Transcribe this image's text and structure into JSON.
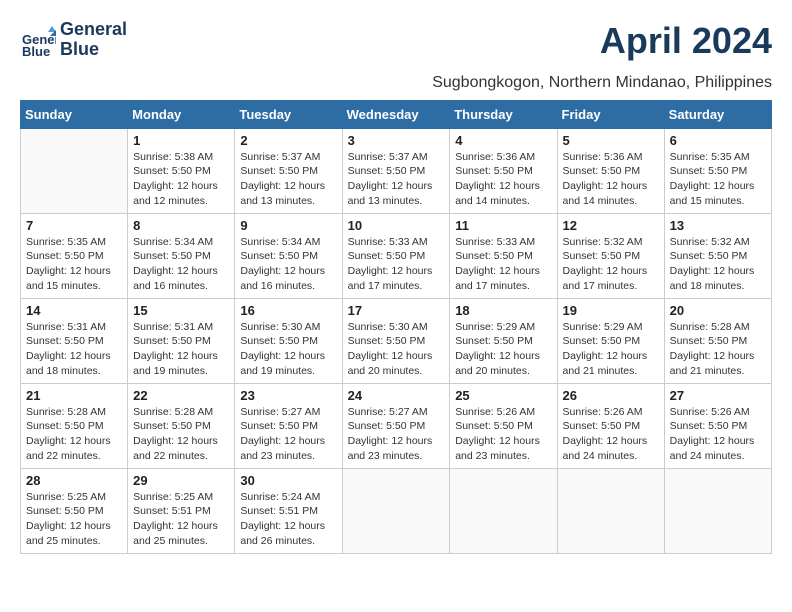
{
  "logo": {
    "line1": "General",
    "line2": "Blue"
  },
  "header": {
    "month_title": "April 2024",
    "location": "Sugbongkogon, Northern Mindanao, Philippines"
  },
  "days_of_week": [
    "Sunday",
    "Monday",
    "Tuesday",
    "Wednesday",
    "Thursday",
    "Friday",
    "Saturday"
  ],
  "weeks": [
    [
      {
        "day": "",
        "info": ""
      },
      {
        "day": "1",
        "info": "Sunrise: 5:38 AM\nSunset: 5:50 PM\nDaylight: 12 hours\nand 12 minutes."
      },
      {
        "day": "2",
        "info": "Sunrise: 5:37 AM\nSunset: 5:50 PM\nDaylight: 12 hours\nand 13 minutes."
      },
      {
        "day": "3",
        "info": "Sunrise: 5:37 AM\nSunset: 5:50 PM\nDaylight: 12 hours\nand 13 minutes."
      },
      {
        "day": "4",
        "info": "Sunrise: 5:36 AM\nSunset: 5:50 PM\nDaylight: 12 hours\nand 14 minutes."
      },
      {
        "day": "5",
        "info": "Sunrise: 5:36 AM\nSunset: 5:50 PM\nDaylight: 12 hours\nand 14 minutes."
      },
      {
        "day": "6",
        "info": "Sunrise: 5:35 AM\nSunset: 5:50 PM\nDaylight: 12 hours\nand 15 minutes."
      }
    ],
    [
      {
        "day": "7",
        "info": "Sunrise: 5:35 AM\nSunset: 5:50 PM\nDaylight: 12 hours\nand 15 minutes."
      },
      {
        "day": "8",
        "info": "Sunrise: 5:34 AM\nSunset: 5:50 PM\nDaylight: 12 hours\nand 16 minutes."
      },
      {
        "day": "9",
        "info": "Sunrise: 5:34 AM\nSunset: 5:50 PM\nDaylight: 12 hours\nand 16 minutes."
      },
      {
        "day": "10",
        "info": "Sunrise: 5:33 AM\nSunset: 5:50 PM\nDaylight: 12 hours\nand 17 minutes."
      },
      {
        "day": "11",
        "info": "Sunrise: 5:33 AM\nSunset: 5:50 PM\nDaylight: 12 hours\nand 17 minutes."
      },
      {
        "day": "12",
        "info": "Sunrise: 5:32 AM\nSunset: 5:50 PM\nDaylight: 12 hours\nand 17 minutes."
      },
      {
        "day": "13",
        "info": "Sunrise: 5:32 AM\nSunset: 5:50 PM\nDaylight: 12 hours\nand 18 minutes."
      }
    ],
    [
      {
        "day": "14",
        "info": "Sunrise: 5:31 AM\nSunset: 5:50 PM\nDaylight: 12 hours\nand 18 minutes."
      },
      {
        "day": "15",
        "info": "Sunrise: 5:31 AM\nSunset: 5:50 PM\nDaylight: 12 hours\nand 19 minutes."
      },
      {
        "day": "16",
        "info": "Sunrise: 5:30 AM\nSunset: 5:50 PM\nDaylight: 12 hours\nand 19 minutes."
      },
      {
        "day": "17",
        "info": "Sunrise: 5:30 AM\nSunset: 5:50 PM\nDaylight: 12 hours\nand 20 minutes."
      },
      {
        "day": "18",
        "info": "Sunrise: 5:29 AM\nSunset: 5:50 PM\nDaylight: 12 hours\nand 20 minutes."
      },
      {
        "day": "19",
        "info": "Sunrise: 5:29 AM\nSunset: 5:50 PM\nDaylight: 12 hours\nand 21 minutes."
      },
      {
        "day": "20",
        "info": "Sunrise: 5:28 AM\nSunset: 5:50 PM\nDaylight: 12 hours\nand 21 minutes."
      }
    ],
    [
      {
        "day": "21",
        "info": "Sunrise: 5:28 AM\nSunset: 5:50 PM\nDaylight: 12 hours\nand 22 minutes."
      },
      {
        "day": "22",
        "info": "Sunrise: 5:28 AM\nSunset: 5:50 PM\nDaylight: 12 hours\nand 22 minutes."
      },
      {
        "day": "23",
        "info": "Sunrise: 5:27 AM\nSunset: 5:50 PM\nDaylight: 12 hours\nand 23 minutes."
      },
      {
        "day": "24",
        "info": "Sunrise: 5:27 AM\nSunset: 5:50 PM\nDaylight: 12 hours\nand 23 minutes."
      },
      {
        "day": "25",
        "info": "Sunrise: 5:26 AM\nSunset: 5:50 PM\nDaylight: 12 hours\nand 23 minutes."
      },
      {
        "day": "26",
        "info": "Sunrise: 5:26 AM\nSunset: 5:50 PM\nDaylight: 12 hours\nand 24 minutes."
      },
      {
        "day": "27",
        "info": "Sunrise: 5:26 AM\nSunset: 5:50 PM\nDaylight: 12 hours\nand 24 minutes."
      }
    ],
    [
      {
        "day": "28",
        "info": "Sunrise: 5:25 AM\nSunset: 5:50 PM\nDaylight: 12 hours\nand 25 minutes."
      },
      {
        "day": "29",
        "info": "Sunrise: 5:25 AM\nSunset: 5:51 PM\nDaylight: 12 hours\nand 25 minutes."
      },
      {
        "day": "30",
        "info": "Sunrise: 5:24 AM\nSunset: 5:51 PM\nDaylight: 12 hours\nand 26 minutes."
      },
      {
        "day": "",
        "info": ""
      },
      {
        "day": "",
        "info": ""
      },
      {
        "day": "",
        "info": ""
      },
      {
        "day": "",
        "info": ""
      }
    ]
  ]
}
